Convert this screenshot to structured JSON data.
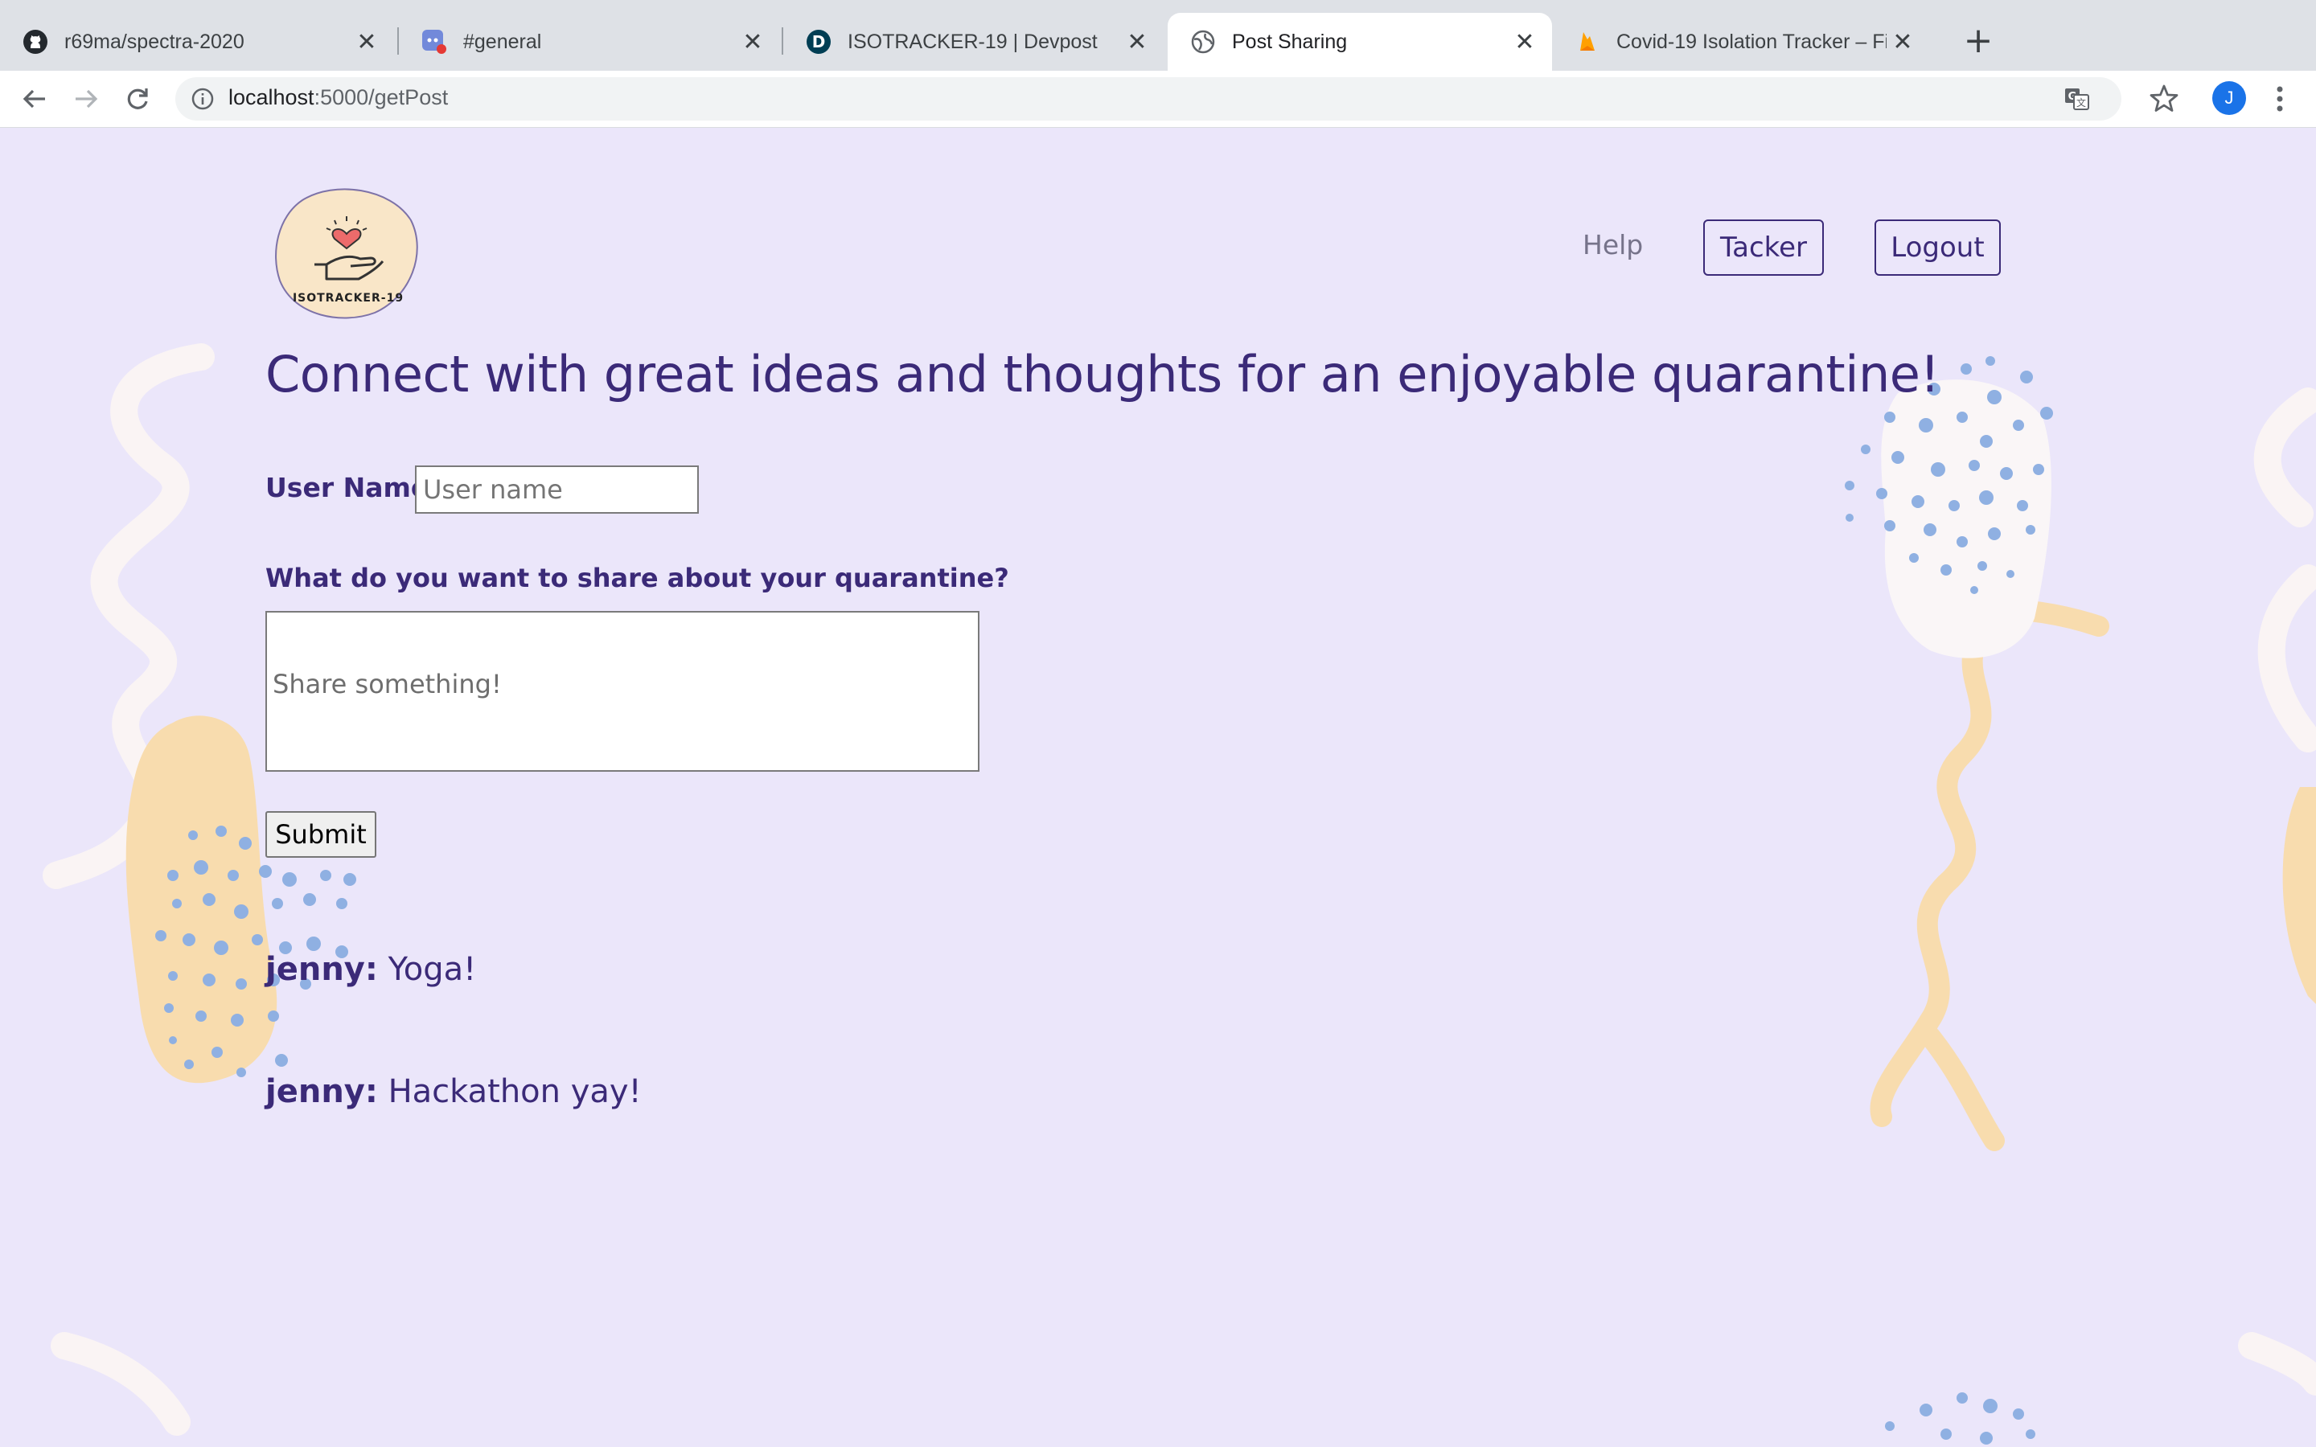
{
  "browser": {
    "tabs": [
      {
        "title": "r69ma/spectra-2020",
        "icon": "github-icon",
        "active": false
      },
      {
        "title": "#general",
        "icon": "discord-icon",
        "active": false
      },
      {
        "title": "ISOTRACKER-19 | Devpost",
        "icon": "devpost-icon",
        "active": false
      },
      {
        "title": "Post Sharing",
        "icon": "globe-icon",
        "active": true
      },
      {
        "title": "Covid-19 Isolation Tracker – Fir",
        "icon": "firebase-icon",
        "active": false
      }
    ],
    "url_host": "localhost",
    "url_rest": ":5000/getPost",
    "profile_initial": "J"
  },
  "logo": {
    "text": "ISOTRACKER-19"
  },
  "nav": {
    "help": "Help",
    "tracker": "Tacker",
    "logout": "Logout"
  },
  "headline": "Connect with great ideas and thoughts for an enjoyable quarantine!",
  "form": {
    "username_label": "User Name",
    "username_placeholder": "User name",
    "share_label": "What do you want to share about your quarantine?",
    "share_placeholder": "Share something!",
    "submit_label": "Submit"
  },
  "posts": [
    {
      "author": "jenny:",
      "text": "Yoga!"
    },
    {
      "author": "jenny:",
      "text": "Hackathon yay!"
    }
  ],
  "colors": {
    "page_bg": "#ebe6fa",
    "accent_text": "#3b2a78",
    "blob_peach": "#f8dcae",
    "dots_blue": "#8fb0e2"
  }
}
